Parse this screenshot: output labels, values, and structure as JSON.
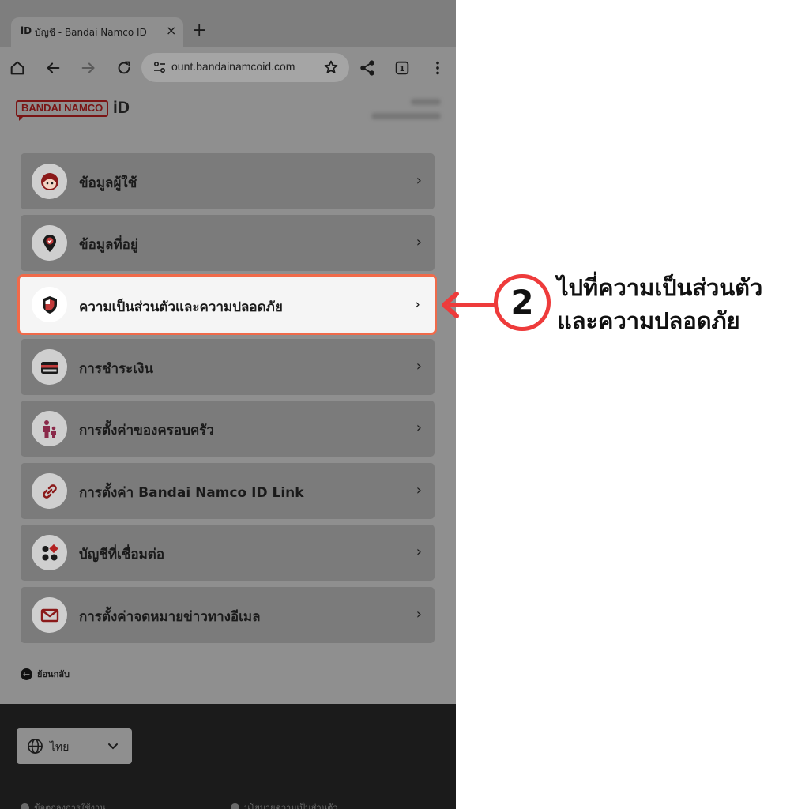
{
  "browser": {
    "tab_favicon": "iD",
    "tab_title": "บัญชี - Bandai Namco ID",
    "tab_close": "×",
    "new_tab": "+",
    "url": "ount.bandainamcoid.com",
    "tab_count": "1",
    "toolbar_icons": [
      "home-icon",
      "back-arrow-icon",
      "forward-arrow-icon",
      "reload-icon",
      "site-settings-icon",
      "star-icon",
      "share-icon",
      "tab-switcher-icon",
      "more-menu-icon"
    ]
  },
  "header": {
    "logo_text": "BANDAI NAMCO",
    "logo_id": "iD"
  },
  "menu": [
    {
      "label": "ข้อมูลผู้ใช้",
      "icon": "user-face-icon",
      "chevron": "›",
      "selected": false
    },
    {
      "label": "ข้อมูลที่อยู่",
      "icon": "location-pin-icon",
      "chevron": "›",
      "selected": false
    },
    {
      "label": "ความเป็นส่วนตัวและความปลอดภัย",
      "icon": "shield-icon",
      "chevron": "›",
      "selected": true
    },
    {
      "label": "การชำระเงิน",
      "icon": "credit-card-icon",
      "chevron": "›",
      "selected": false
    },
    {
      "label": "การตั้งค่าของครอบครัว",
      "icon": "family-icon",
      "chevron": "›",
      "selected": false
    },
    {
      "label": "การตั้งค่า Bandai Namco ID Link",
      "icon": "link-icon",
      "chevron": "›",
      "selected": false
    },
    {
      "label": "บัญชีที่เชื่อมต่อ",
      "icon": "connected-accounts-icon",
      "chevron": "›",
      "selected": false
    },
    {
      "label": "การตั้งค่าจดหมายข่าวทางอีเมล",
      "icon": "mail-icon",
      "chevron": "›",
      "selected": false
    }
  ],
  "back": {
    "label": "ย้อนกลับ",
    "icon": "←"
  },
  "footer": {
    "language": "ไทย",
    "links": [
      "ข้อตกลงการใช้งาน",
      "นโยบายความเป็นส่วนตัว"
    ]
  },
  "annotation": {
    "step": "2",
    "line1": "ไปที่ความเป็นส่วนตัว",
    "line2": "และความปลอดภัย",
    "accent_color": "#ee3b3b",
    "highlight_color": "#f06a4a"
  }
}
